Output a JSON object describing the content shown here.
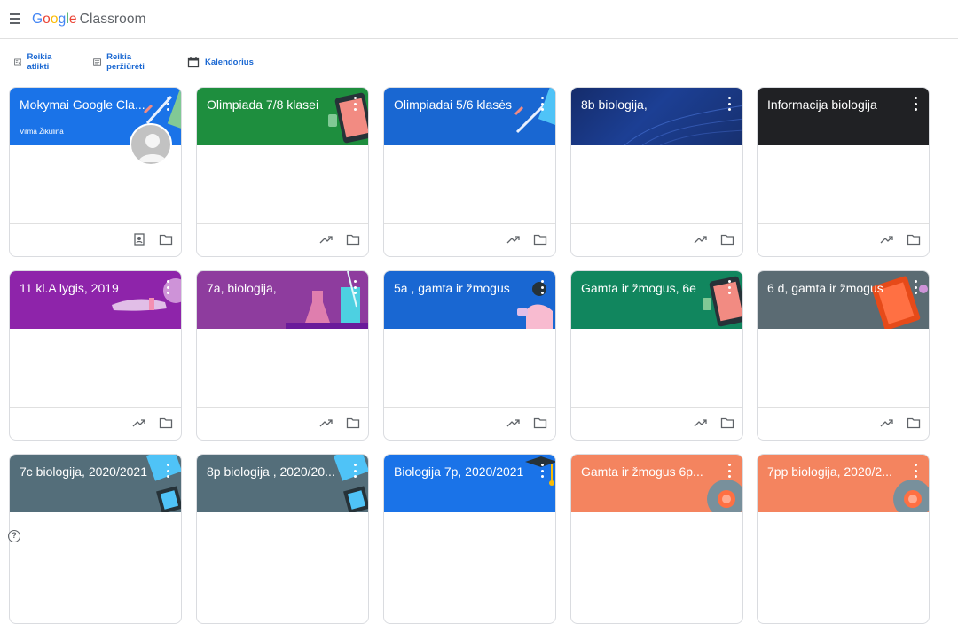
{
  "app": {
    "brand_google": [
      "G",
      "o",
      "o",
      "g",
      "l",
      "e"
    ],
    "brand_product": "Classroom"
  },
  "quick_links": [
    {
      "label": "Reikia atlikti",
      "icon": "todo-icon"
    },
    {
      "label": "Reikia peržiūrėti",
      "icon": "review-icon"
    },
    {
      "label": "Kalendorius",
      "icon": "calendar-icon"
    }
  ],
  "classes": [
    {
      "title": "Mokymai Google Cla...",
      "owner": "Vilma Žikulina",
      "color": "#1a73e8",
      "teacher_footer": false
    },
    {
      "title": "Olimpiada 7/8 klasei",
      "color": "#1e8e3e",
      "teacher_footer": true
    },
    {
      "title": "Olimpiadai 5/6 klasės",
      "color": "#1967d2",
      "teacher_footer": true
    },
    {
      "title": "8b biologija,",
      "color": "#1a3a8a",
      "teacher_footer": true
    },
    {
      "title": "Informacija biologija",
      "color": "#202124",
      "teacher_footer": true
    },
    {
      "title": "11 kl.A lygis, 2019",
      "color": "#8e24aa",
      "teacher_footer": true
    },
    {
      "title": "7a, biologija,",
      "color": "#8e3c9e",
      "teacher_footer": true
    },
    {
      "title": "5a , gamta ir žmogus",
      "color": "#1967d2",
      "teacher_footer": true
    },
    {
      "title": "Gamta ir žmogus, 6e",
      "color": "#11865e",
      "teacher_footer": true
    },
    {
      "title": "6 d, gamta ir žmogus",
      "color": "#5b6b73",
      "teacher_footer": true
    },
    {
      "title": "7c biologija, 2020/2021",
      "color": "#546e7a",
      "teacher_footer": true
    },
    {
      "title": "8p biologija , 2020/20...",
      "color": "#546e7a",
      "teacher_footer": true
    },
    {
      "title": "Biologija 7p, 2020/2021",
      "color": "#1a73e8",
      "teacher_footer": true
    },
    {
      "title": "Gamta ir žmogus 6p...",
      "color": "#f4845f",
      "teacher_footer": true
    },
    {
      "title": "7pp biologija, 2020/2...",
      "color": "#f4845f",
      "teacher_footer": true
    }
  ],
  "icons": {
    "menu": "hamburger-menu-icon",
    "more": "more-vert-icon",
    "progress": "trending-up-icon",
    "folder": "folder-icon",
    "portfolio": "student-work-icon",
    "help": "help-icon"
  },
  "help_label": "?"
}
